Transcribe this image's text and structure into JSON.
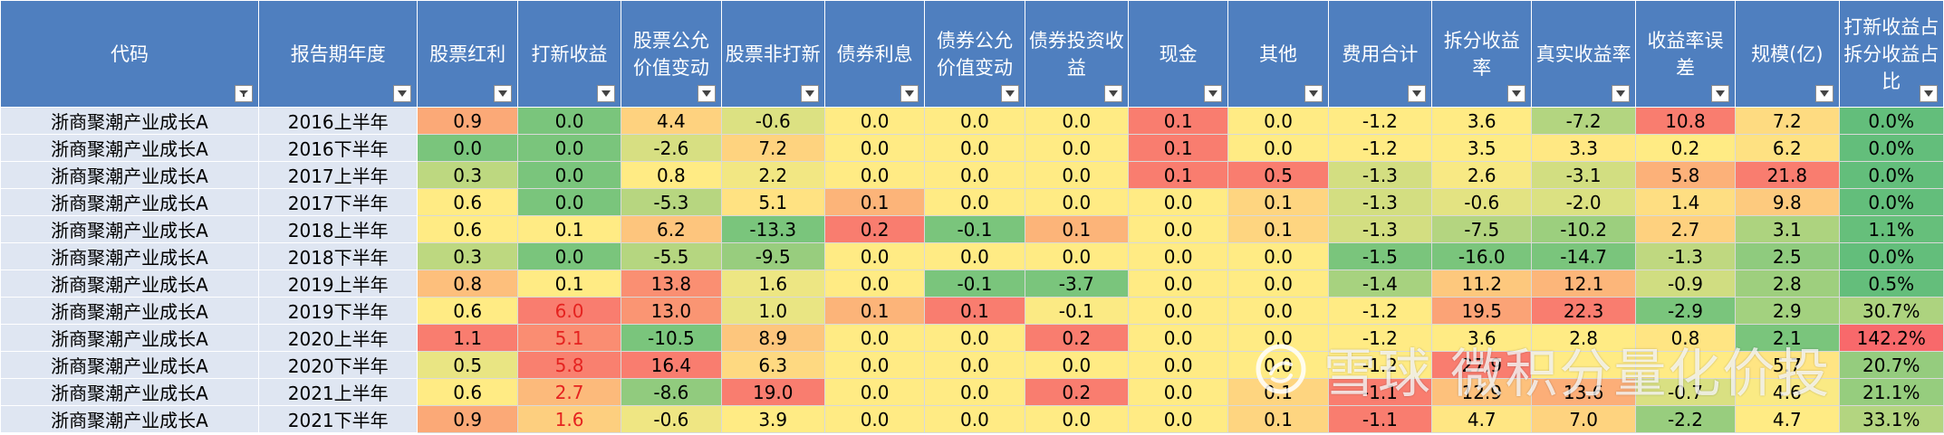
{
  "headers": [
    {
      "label": "代码",
      "filter": "active"
    },
    {
      "label": "报告期年度",
      "filter": "dropdown"
    },
    {
      "label": "股票红利",
      "filter": "dropdown"
    },
    {
      "label": "打新收益",
      "filter": "dropdown"
    },
    {
      "label": "股票公允价值变动",
      "filter": "dropdown"
    },
    {
      "label": "股票非打新",
      "filter": "dropdown"
    },
    {
      "label": "债券利息",
      "filter": "dropdown"
    },
    {
      "label": "债券公允价值变动",
      "filter": "dropdown"
    },
    {
      "label": "债券投资收益",
      "filter": "dropdown"
    },
    {
      "label": "现金",
      "filter": "dropdown"
    },
    {
      "label": "其他",
      "filter": "dropdown"
    },
    {
      "label": "费用合计",
      "filter": "dropdown"
    },
    {
      "label": "拆分收益率",
      "filter": "dropdown"
    },
    {
      "label": "真实收益率",
      "filter": "dropdown"
    },
    {
      "label": "收益率误差",
      "filter": "dropdown"
    },
    {
      "label": "规模(亿)",
      "filter": "dropdown"
    },
    {
      "label": "打新收益占拆分收益占比",
      "filter": "dropdown"
    }
  ],
  "rows": [
    {
      "cells": [
        "浙商聚潮产业成长A",
        "2016上半年",
        "0.9",
        "0.0",
        "4.4",
        "-0.6",
        "0.0",
        "0.0",
        "0.0",
        "0.1",
        "0.0",
        "-1.2",
        "3.6",
        "-7.2",
        "10.8",
        "7.2",
        "0.0%"
      ]
    },
    {
      "cells": [
        "浙商聚潮产业成长A",
        "2016下半年",
        "0.0",
        "0.0",
        "-2.6",
        "7.2",
        "0.0",
        "0.0",
        "0.0",
        "0.1",
        "0.0",
        "-1.2",
        "3.5",
        "3.3",
        "0.2",
        "6.2",
        "0.0%"
      ]
    },
    {
      "cells": [
        "浙商聚潮产业成长A",
        "2017上半年",
        "0.3",
        "0.0",
        "0.8",
        "2.2",
        "0.0",
        "0.0",
        "0.0",
        "0.1",
        "0.5",
        "-1.3",
        "2.6",
        "-3.1",
        "5.8",
        "21.8",
        "0.0%"
      ]
    },
    {
      "cells": [
        "浙商聚潮产业成长A",
        "2017下半年",
        "0.6",
        "0.0",
        "-5.3",
        "5.1",
        "0.1",
        "0.0",
        "0.0",
        "0.0",
        "0.1",
        "-1.3",
        "-0.6",
        "-2.0",
        "1.4",
        "9.8",
        "0.0%"
      ]
    },
    {
      "cells": [
        "浙商聚潮产业成长A",
        "2018上半年",
        "0.6",
        "0.1",
        "6.2",
        "-13.3",
        "0.2",
        "-0.1",
        "0.1",
        "0.0",
        "0.1",
        "-1.3",
        "-7.5",
        "-10.2",
        "2.7",
        "3.1",
        "1.1%"
      ]
    },
    {
      "cells": [
        "浙商聚潮产业成长A",
        "2018下半年",
        "0.3",
        "0.0",
        "-5.5",
        "-9.5",
        "0.0",
        "0.0",
        "0.0",
        "0.0",
        "0.0",
        "-1.5",
        "-16.0",
        "-14.7",
        "-1.3",
        "2.5",
        "0.0%"
      ]
    },
    {
      "cells": [
        "浙商聚潮产业成长A",
        "2019上半年",
        "0.8",
        "0.1",
        "13.8",
        "1.6",
        "0.0",
        "-0.1",
        "-3.7",
        "0.0",
        "0.0",
        "-1.4",
        "11.2",
        "12.1",
        "-0.9",
        "2.8",
        "0.5%"
      ]
    },
    {
      "cells": [
        "浙商聚潮产业成长A",
        "2019下半年",
        "0.6",
        "6.0",
        "13.0",
        "1.0",
        "0.1",
        "0.1",
        "-0.1",
        "0.0",
        "0.0",
        "-1.2",
        "19.5",
        "22.3",
        "-2.9",
        "2.9",
        "30.7%"
      ]
    },
    {
      "cells": [
        "浙商聚潮产业成长A",
        "2020上半年",
        "1.1",
        "5.1",
        "-10.5",
        "8.9",
        "0.0",
        "0.0",
        "0.2",
        "0.0",
        "0.0",
        "-1.2",
        "3.6",
        "2.8",
        "0.8",
        "2.1",
        "142.2%"
      ]
    },
    {
      "cells": [
        "浙商聚潮产业成长A",
        "2020下半年",
        "0.5",
        "5.8",
        "16.4",
        "6.3",
        "0.0",
        "0.0",
        "0.0",
        "0.0",
        "0.0",
        "-1.2",
        "27.9",
        "",
        "",
        "5.7",
        "20.7%"
      ]
    },
    {
      "cells": [
        "浙商聚潮产业成长A",
        "2021上半年",
        "0.6",
        "2.7",
        "-8.6",
        "19.0",
        "0.0",
        "0.0",
        "0.2",
        "0.0",
        "0.1",
        "-1.1",
        "12.9",
        "13.6",
        "-0.7",
        "4.6",
        "21.1%"
      ]
    },
    {
      "cells": [
        "浙商聚潮产业成长A",
        "2021下半年",
        "0.9",
        "1.6",
        "-0.6",
        "3.9",
        "0.0",
        "0.0",
        "0.0",
        "0.0",
        "0.1",
        "-1.1",
        "4.7",
        "7.0",
        "-2.2",
        "4.7",
        "33.1%"
      ]
    }
  ],
  "watermark": {
    "text": "雪球  微积分量化价投"
  },
  "colors": {
    "header_bg": "#4f7fbf",
    "label_bg": "#dfe6f2",
    "heat_yellow": "#ffeb84",
    "heat_red": "#f8696b",
    "heat_green": "#63be7b",
    "red_text": "#e52320"
  }
}
